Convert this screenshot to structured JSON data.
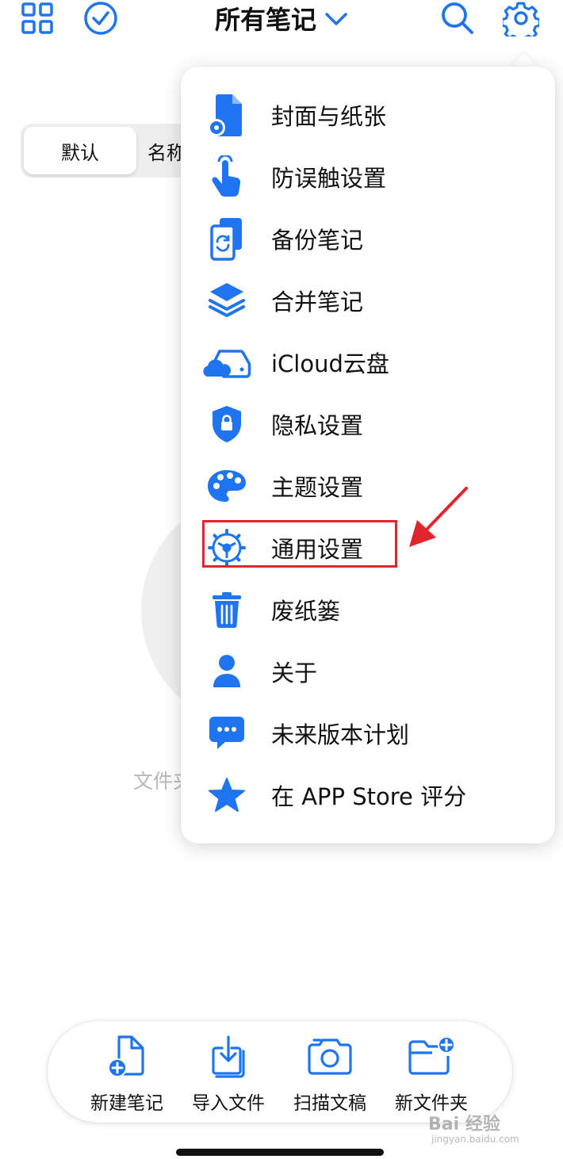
{
  "colors": {
    "accent": "#1f74f0",
    "highlight": "#e0252b",
    "text": "#111111",
    "muted": "#b5b8bd"
  },
  "topbar": {
    "title": "所有笔记",
    "left_icons": [
      "grid-icon",
      "check-circle-icon"
    ],
    "right_icons": [
      "search-icon",
      "gear-icon"
    ]
  },
  "segment": {
    "active": "默认",
    "other": "名称"
  },
  "empty_state": {
    "text": "文件夹"
  },
  "menu": {
    "items": [
      {
        "label": "封面与纸张",
        "icon": "document-gear-icon"
      },
      {
        "label": "防误触设置",
        "icon": "hand-tap-icon"
      },
      {
        "label": "备份笔记",
        "icon": "backup-sync-icon"
      },
      {
        "label": "合并笔记",
        "icon": "layers-icon"
      },
      {
        "label": "iCloud云盘",
        "icon": "icloud-drive-icon"
      },
      {
        "label": "隐私设置",
        "icon": "lock-shield-icon"
      },
      {
        "label": "主题设置",
        "icon": "palette-icon"
      },
      {
        "label": "通用设置",
        "icon": "gear-wheel-icon"
      },
      {
        "label": "废纸篓",
        "icon": "trash-icon"
      },
      {
        "label": "关于",
        "icon": "person-icon"
      },
      {
        "label": "未来版本计划",
        "icon": "chat-bubble-icon"
      },
      {
        "label": "在 APP Store 评分",
        "icon": "star-icon"
      }
    ],
    "highlighted": "通用设置"
  },
  "bottombar": {
    "items": [
      {
        "label": "新建笔记",
        "icon": "new-note-icon"
      },
      {
        "label": "导入文件",
        "icon": "import-icon"
      },
      {
        "label": "扫描文稿",
        "icon": "camera-icon"
      },
      {
        "label": "新文件夹",
        "icon": "new-folder-icon"
      }
    ]
  },
  "watermark": {
    "main": "Bai 经验",
    "sub": "jingyan.baidu.com"
  }
}
